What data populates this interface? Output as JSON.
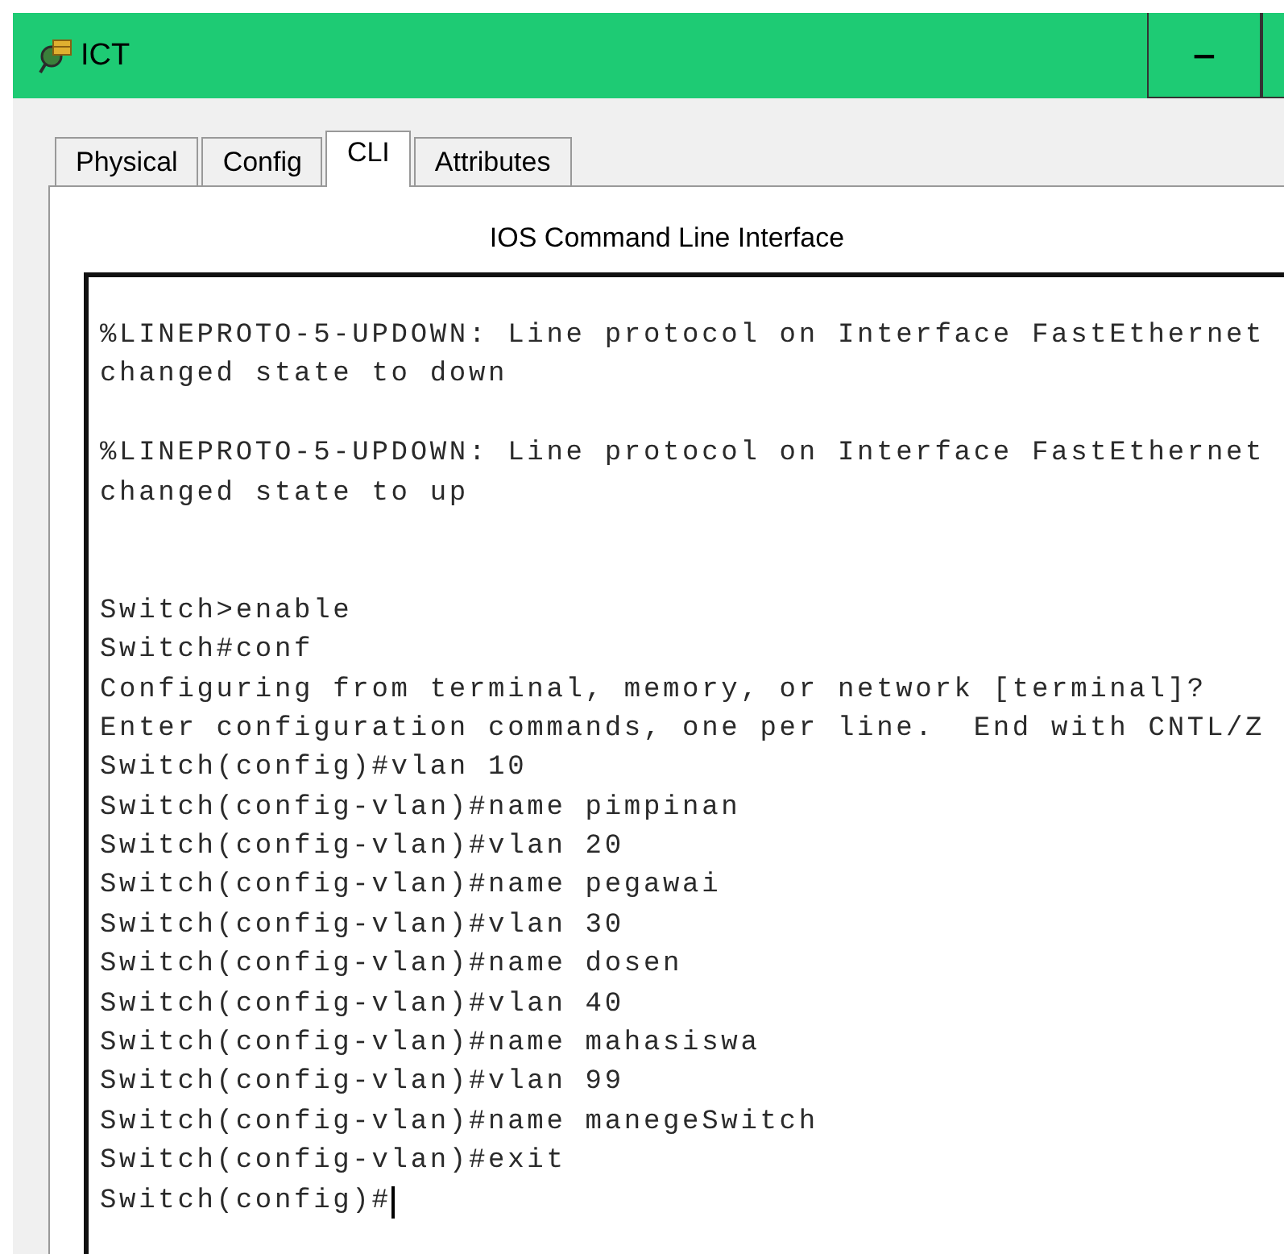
{
  "window": {
    "title": "ICT",
    "buttons": [
      {
        "kind": "minimize",
        "label": "‒"
      },
      {
        "kind": "maximize"
      }
    ]
  },
  "tabs": [
    {
      "label": "Physical",
      "selected": false
    },
    {
      "label": "Config",
      "selected": false
    },
    {
      "label": "CLI",
      "selected": true
    },
    {
      "label": "Attributes",
      "selected": false
    }
  ],
  "panel_title": "IOS Command Line Interface",
  "terminal": {
    "blocks": [
      {
        "kind": "log",
        "lines": [
          "%LINEPROTO-5-UPDOWN: Line protocol on Interface FastEthernet",
          "changed state to down"
        ]
      },
      {
        "kind": "log",
        "lines": [
          "%LINEPROTO-5-UPDOWN: Line protocol on Interface FastEthernet",
          "changed state to up"
        ]
      },
      {
        "kind": "session",
        "lines": [
          "Switch>enable",
          "Switch#conf",
          "Configuring from terminal, memory, or network [terminal]?",
          "Enter configuration commands, one per line.  End with CNTL/Z",
          "Switch(config)#vlan 10",
          "Switch(config-vlan)#name pimpinan",
          "Switch(config-vlan)#vlan 20",
          "Switch(config-vlan)#name pegawai",
          "Switch(config-vlan)#vlan 30",
          "Switch(config-vlan)#name dosen",
          "Switch(config-vlan)#vlan 40",
          "Switch(config-vlan)#name mahasiswa",
          "Switch(config-vlan)#vlan 99",
          "Switch(config-vlan)#name manegeSwitch",
          "Switch(config-vlan)#exit",
          "Switch(config)#"
        ]
      }
    ],
    "cursor": true
  }
}
